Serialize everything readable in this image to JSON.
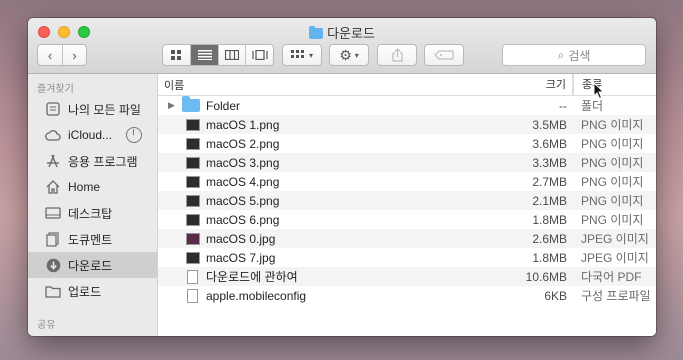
{
  "window": {
    "title": "다운로드",
    "traffic_lights": [
      "close",
      "minimize",
      "zoom"
    ]
  },
  "toolbar": {
    "back_icon": "chevron-left-icon",
    "forward_icon": "chevron-right-icon",
    "view_modes": [
      "icon-view-icon",
      "list-view-icon",
      "column-view-icon",
      "gallery-view-icon"
    ],
    "active_view": "list-view-icon",
    "arrange_icon": "arrange-grid-icon",
    "action_icon": "gear-icon",
    "share_icon": "share-icon",
    "tag_icon": "tag-icon",
    "search_placeholder": "검색"
  },
  "sidebar": {
    "favorites_header": "즐겨찾기",
    "items": [
      {
        "label": "나의 모든 파일",
        "icon": "all-files-icon"
      },
      {
        "label": "iCloud...",
        "icon": "cloud-icon"
      },
      {
        "label": "응용 프로그램",
        "icon": "applications-icon"
      },
      {
        "label": "Home",
        "icon": "home-icon"
      },
      {
        "label": "데스크탑",
        "icon": "desktop-icon"
      },
      {
        "label": "도큐멘트",
        "icon": "documents-icon"
      },
      {
        "label": "다운로드",
        "icon": "downloads-icon",
        "selected": true
      },
      {
        "label": "업로드",
        "icon": "folder-icon"
      }
    ],
    "shared_header": "공유"
  },
  "columns": {
    "name": "이름",
    "size": "크기",
    "kind": "종류"
  },
  "files": [
    {
      "name": "Folder",
      "size": "--",
      "kind": "폴더",
      "type": "folder"
    },
    {
      "name": "macOS 1.png",
      "size": "3.5MB",
      "kind": "PNG 이미지",
      "type": "png"
    },
    {
      "name": "macOS 2.png",
      "size": "3.6MB",
      "kind": "PNG 이미지",
      "type": "png"
    },
    {
      "name": "macOS 3.png",
      "size": "3.3MB",
      "kind": "PNG 이미지",
      "type": "png"
    },
    {
      "name": "macOS 4.png",
      "size": "2.7MB",
      "kind": "PNG 이미지",
      "type": "png"
    },
    {
      "name": "macOS 5.png",
      "size": "2.1MB",
      "kind": "PNG 이미지",
      "type": "png"
    },
    {
      "name": "macOS 6.png",
      "size": "1.8MB",
      "kind": "PNG 이미지",
      "type": "png"
    },
    {
      "name": "macOS 0.jpg",
      "size": "2.6MB",
      "kind": "JPEG 이미지",
      "type": "jpg"
    },
    {
      "name": "macOS 7.jpg",
      "size": "1.8MB",
      "kind": "JPEG 이미지",
      "type": "jpg"
    },
    {
      "name": "다운로드에 관하여",
      "size": "10.6MB",
      "kind": "다국어 PDF",
      "type": "doc"
    },
    {
      "name": "apple.mobileconfig",
      "size": "6KB",
      "kind": "구성 프로파일",
      "type": "doc"
    }
  ]
}
